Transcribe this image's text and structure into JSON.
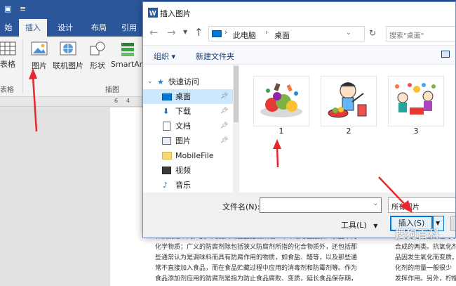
{
  "word": {
    "title_glyph": "≡",
    "tabs": [
      {
        "label": "始",
        "active": false
      },
      {
        "label": "插入",
        "active": true
      },
      {
        "label": "设计",
        "active": false
      },
      {
        "label": "布局",
        "active": false
      },
      {
        "label": "引用",
        "active": false
      }
    ],
    "ribbon": {
      "table_label": "表格",
      "table_group": "表格",
      "picture_label": "图片",
      "online_picture_label": "联机图片",
      "shapes_label": "形状",
      "smartart_label": "SmartArt",
      "illustrations_group": "插图"
    },
    "ruler_numbers": [
      "6",
      "4"
    ],
    "doc_left_lines": [
      "和疾病之不同。狭义的防腐剂主要指山梨酸、苯甲酸等直接加入食品中的",
      "化学物质；广义的防腐剂除包括狭义防腐剂所指的化合物质外，还包括那",
      "些通常认为是调味料而具有防腐作用的物质，如食盐、醋等，以及那些通",
      "常不直接加入食品，而在食品贮藏过程中应用的消毒剂和防霉剂等。作为",
      "食品添加剂应用的防腐剂是指为防止食品腐败、变质，延长食品保存期，"
    ],
    "doc_right_lines": [
      "氧剂可分为脂溶性与水溶",
      "合成的两类。抗氧化剂能够",
      "品因发生氧化而变质。因此",
      "化剂的用量一般很少（0.002",
      "发挥作用。另外，柠檬酸、酒"
    ]
  },
  "dialog": {
    "title": "插入图片",
    "breadcrumb": [
      "此电脑",
      "桌面"
    ],
    "search_placeholder": "搜索\"桌面\"",
    "organize_label": "组织 ▾",
    "new_folder_label": "新建文件夹",
    "nav_items": [
      {
        "label": "快速访问",
        "icon": "star-icon",
        "pinned": false,
        "selected": false
      },
      {
        "label": "桌面",
        "icon": "desktop-icon",
        "pinned": true,
        "selected": true
      },
      {
        "label": "下载",
        "icon": "download-icon",
        "pinned": true,
        "selected": false
      },
      {
        "label": "文档",
        "icon": "documents-icon",
        "pinned": true,
        "selected": false
      },
      {
        "label": "图片",
        "icon": "pictures-icon",
        "pinned": true,
        "selected": false
      },
      {
        "label": "MobileFile",
        "icon": "folder-icon",
        "pinned": false,
        "selected": false
      },
      {
        "label": "视频",
        "icon": "video-icon",
        "pinned": false,
        "selected": false
      },
      {
        "label": "音乐",
        "icon": "music-icon",
        "pinned": false,
        "selected": false
      }
    ],
    "files": [
      {
        "label": "1",
        "icon": "food-image-icon"
      },
      {
        "label": "2",
        "icon": "person-cooking-image-icon"
      },
      {
        "label": "3",
        "icon": "people-party-image-icon"
      }
    ],
    "filename_label": "文件名(N):",
    "filename_value": "",
    "file_type": "所有图片",
    "tools_label": "工具(L)",
    "insert_label": "插入(S)"
  },
  "watermark": "搜狗百科",
  "colors": {
    "word_blue": "#2b579a",
    "accent": "#0078d7",
    "arrow_red": "#e8262d",
    "selection": "#cce8ff"
  }
}
